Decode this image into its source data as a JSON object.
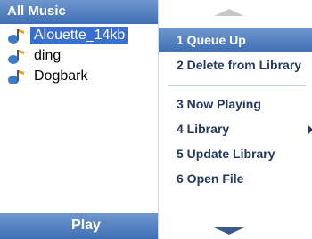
{
  "header": {
    "title": "All Music"
  },
  "list": {
    "items": [
      {
        "label": "Alouette_14kb",
        "selected": true
      },
      {
        "label": "ding",
        "selected": false
      },
      {
        "label": "Dogbark",
        "selected": false
      }
    ]
  },
  "softkey": {
    "left_label": "Play"
  },
  "menu": {
    "items": [
      {
        "label": "1 Queue Up",
        "highlighted": true
      },
      {
        "label": "2 Delete from Library"
      },
      {
        "label": "3 Now Playing"
      },
      {
        "label": "4 Library",
        "has_submenu": true
      },
      {
        "label": "5 Update Library"
      },
      {
        "label": "6 Open File"
      }
    ]
  },
  "colors": {
    "accent": "#3f6fb4",
    "selection": "#3a6fcf",
    "menu_text": "#23395f"
  }
}
